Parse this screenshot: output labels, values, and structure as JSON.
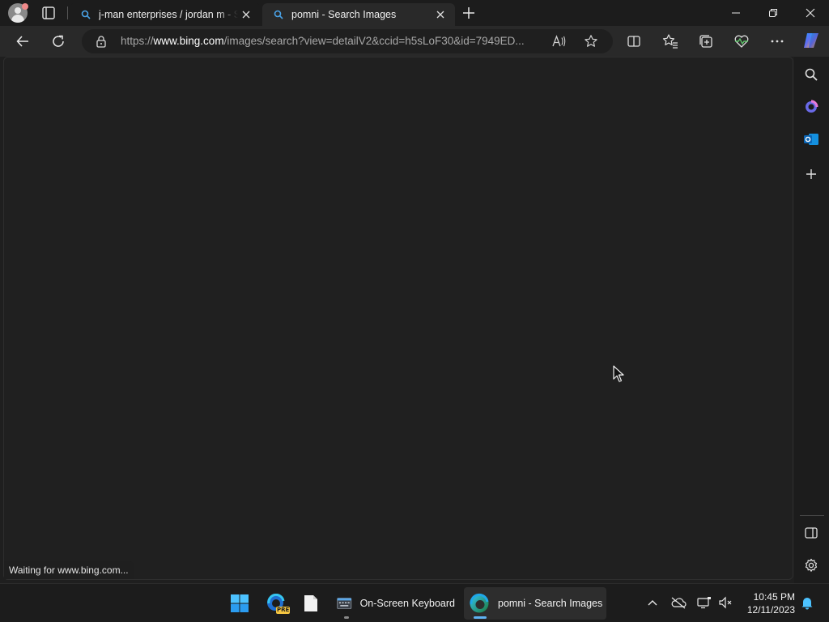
{
  "browser": {
    "tabs": [
      {
        "title": "j-man enterprises / jordan m - Se",
        "active": false
      },
      {
        "title": "pomni - Search Images",
        "active": true
      }
    ],
    "url": {
      "prefix": "https://",
      "host": "www.bing.com",
      "path": "/images/search?view=detailV2&ccid=h5sLoF30&id=7949ED..."
    },
    "status_text": "Waiting for www.bing.com..."
  },
  "taskbar": {
    "keyboard_label": "On-Screen Keyboard",
    "edge_label": "pomni - Search Images",
    "time": "10:45 PM",
    "date": "12/11/2023",
    "edge_badge": "PRE"
  },
  "colors": {
    "accent": "#5fb2f2",
    "content_bg": "#202020",
    "toolbar_bg": "#292929"
  }
}
